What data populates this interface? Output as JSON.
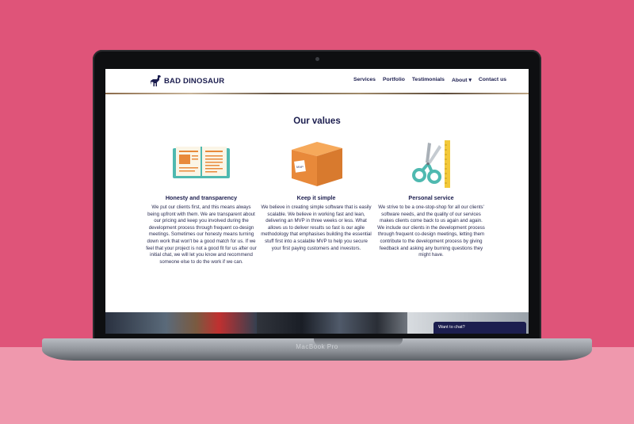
{
  "device": {
    "label": "MacBook Pro"
  },
  "site": {
    "logo_text": "BAD DINOSAUR",
    "nav": [
      {
        "label": "Services"
      },
      {
        "label": "Portfolio"
      },
      {
        "label": "Testimonials"
      },
      {
        "label": "About ▾"
      },
      {
        "label": "Contact us"
      }
    ]
  },
  "values": {
    "heading": "Our values",
    "items": [
      {
        "icon": "book-icon",
        "title": "Honesty and transparency",
        "body": "We put our clients first, and this means always being upfront with them. We are transparent about our pricing and keep you involved during the development process through frequent co-design meetings. Sometimes our honesty means turning down work that won't be a good match for us. If we feel that your project is not a good fit for us after our initial chat, we will let you know and recommend someone else to do the work if we can."
      },
      {
        "icon": "box-icon",
        "box_label": "MVP",
        "title": "Keep it simple",
        "body": "We believe in creating simple software that is easily scalable. We believe in working fast and lean, delivering an MVP in three weeks or less. What allows us to deliver results so fast is our agile methodology that emphasises building the essential stuff first into a scalable MVP to help you secure your first paying customers and investors."
      },
      {
        "icon": "scissors-icon",
        "title": "Personal service",
        "body": "We strive to be a one-stop-shop for all our clients' software needs, and the quality of our services makes clients come back to us again and again. We include our clients in the development process through frequent co-design meetings, letting them contribute to the development process by giving feedback and asking any burning questions they might have."
      }
    ]
  },
  "chat": {
    "label": "Want to chat?"
  },
  "colors": {
    "background": "#df5479",
    "floor": "#ef98ad",
    "brand_navy": "#1c1e4f",
    "teal": "#4fb9b0",
    "orange": "#e8893a"
  }
}
